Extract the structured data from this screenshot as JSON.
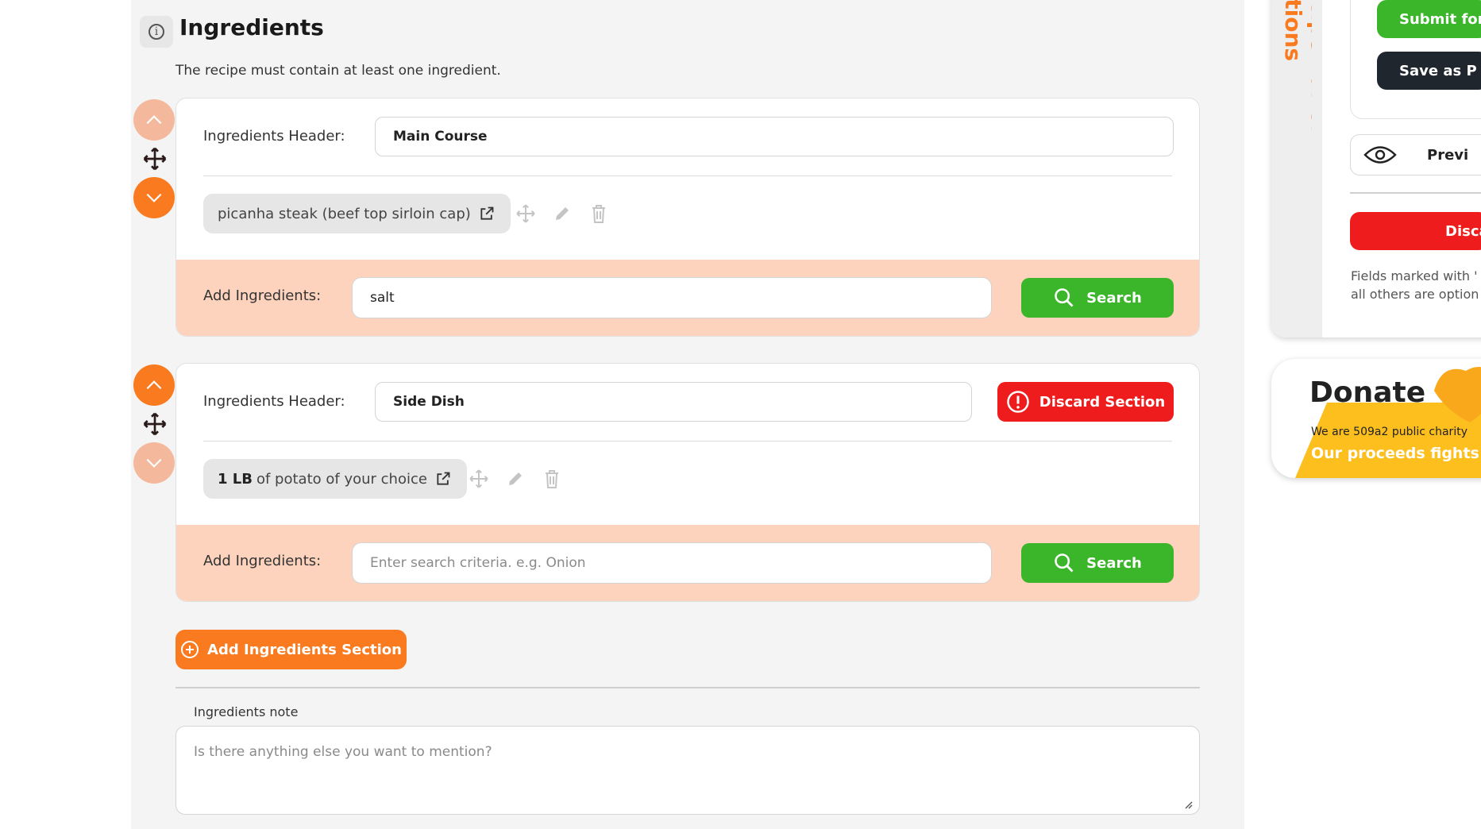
{
  "section": {
    "title": "Ingredients",
    "subtitle": "The recipe must contain at least one ingredient."
  },
  "sections": [
    {
      "header_label": "Ingredients Header:",
      "header_value": "Main Course",
      "ingredient": {
        "text": "picanha steak (beef top sirloin cap)"
      },
      "add_label": "Add Ingredients:",
      "add_value": "salt",
      "search_label": "Search"
    },
    {
      "header_label": "Ingredients Header:",
      "header_value": "Side Dish",
      "discard_label": "Discard Section",
      "ingredient": {
        "quantity": "1 LB",
        "text": "of potato of your choice"
      },
      "add_label": "Add Ingredients:",
      "add_placeholder": "Enter search criteria. e.g. Onion",
      "search_label": "Search"
    }
  ],
  "add_section_label": "Add Ingredients Section",
  "note": {
    "label": "Ingredients note",
    "placeholder": "Is there anything else you want to mention?"
  },
  "sidebar": {
    "tab_label": "Recipe Editor Actions",
    "submit_label": "Submit for A",
    "save_label": "Save as P",
    "preview_label": "Previ",
    "discard_label": "Disca",
    "note_line1": "Fields marked with '",
    "note_line2": "all others are option"
  },
  "donate": {
    "title": "Donate",
    "subtitle": "We are 509a2 public charity",
    "tagline": "Our proceeds fights h"
  },
  "colors": {
    "accent_orange": "#f97a1f",
    "search_green": "#3bb52a",
    "danger_red": "#ee1c1c",
    "band_peach": "#fdd3bd",
    "dark_button": "#1f262e",
    "donate_yellow": "#fcbf1e"
  }
}
